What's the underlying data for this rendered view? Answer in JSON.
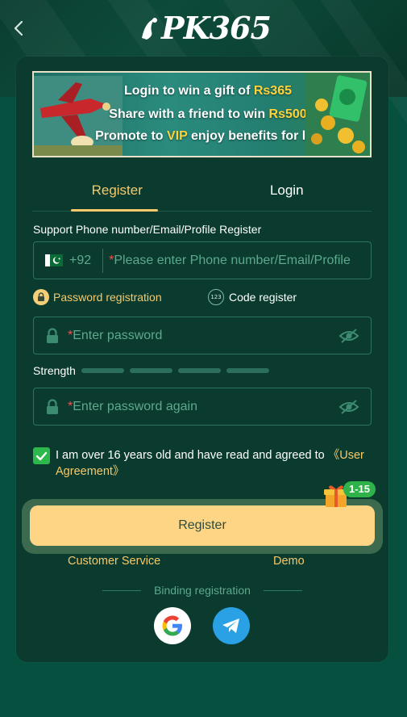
{
  "header": {
    "back_icon": "chevron-left-icon",
    "logo_text": "PK365"
  },
  "banner": {
    "line1_pre": "Login to win a gift of ",
    "line1_hl": "Rs365",
    "line2_pre": "Share with a friend to win ",
    "line2_hl": "Rs500",
    "line3_pre": "Promote to ",
    "line3_hl": "VIP",
    "line3_post": " enjoy benefits for life"
  },
  "tabs": [
    {
      "label": "Register",
      "active": true
    },
    {
      "label": "Login",
      "active": false
    }
  ],
  "form": {
    "support_text": "Support Phone number/Email/Profile Register",
    "dial_code": "+92",
    "phone_placeholder": "Please enter Phone number/Email/Profile",
    "required_mark": "*",
    "option_password": "Password registration",
    "option_code": "Code register",
    "code_icon_text": "123",
    "password_placeholder": "Enter password",
    "strength_label": "Strength",
    "strength_level": 0,
    "strength_bars": 4,
    "password_again_placeholder": "Enter password again",
    "agree_text": "I am over 16 years old and have read and agreed to ",
    "agree_link": "《User Agreement》",
    "agree_checked": true,
    "register_button": "Register",
    "promo_badge": "1-15"
  },
  "links": {
    "customer_service": "Customer Service",
    "demo": "Demo"
  },
  "binding": {
    "label": "Binding registration",
    "providers": [
      "google-icon",
      "telegram-icon"
    ]
  },
  "colors": {
    "background": "#06503f",
    "card": "#0a3b2e",
    "accent": "#f7c96a",
    "button": "#fdd585",
    "placeholder": "#5da98e",
    "check": "#2db84c"
  }
}
